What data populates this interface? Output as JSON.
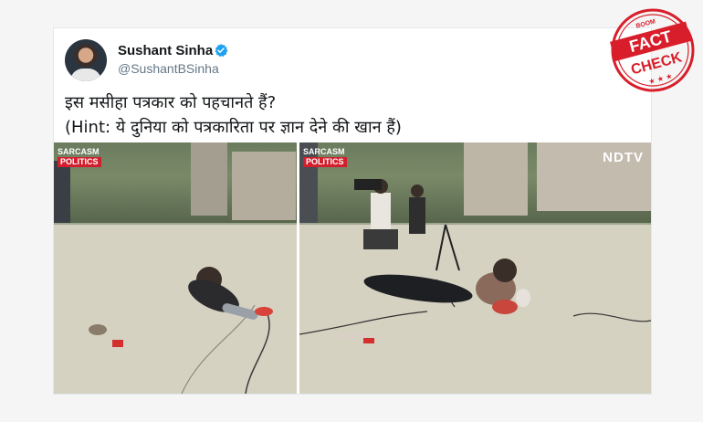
{
  "tweet": {
    "author_name": "Sushant Sinha",
    "author_handle": "@SushantBSinha",
    "verified": true,
    "text_lines": [
      "इस मसीहा पत्रकार को पहचानते हैं?",
      "(Hint: ये दुनिया को पत्रकारिता पर ज्ञान देने की खान हैं)"
    ]
  },
  "media": {
    "left_frame": {
      "show_logo_line1": "SARCASM",
      "show_logo_line2": "POLITICS"
    },
    "right_frame": {
      "show_logo_line1": "SARCASM",
      "show_logo_line2": "POLITICS",
      "channel_logo": "NDTV"
    }
  },
  "stamp": {
    "small_text": "BOOM",
    "word1": "FACT",
    "word2": "CHECK",
    "color": "#d81e2a"
  },
  "icons": [
    "verified-icon",
    "chevron-down-icon"
  ]
}
